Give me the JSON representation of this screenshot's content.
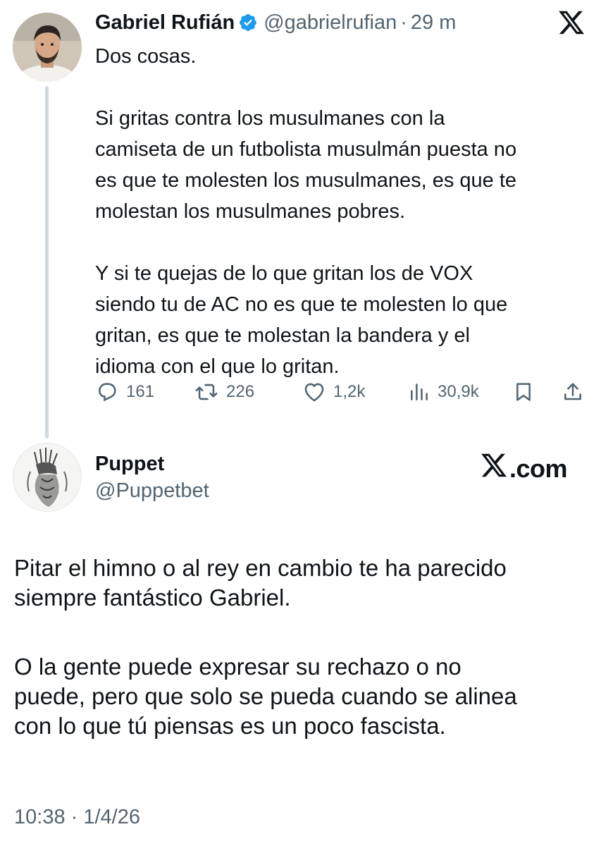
{
  "main_tweet": {
    "author_name": "Gabriel Rufián",
    "handle": "@gabrielrufian",
    "separator": "·",
    "time_ago": "29 m",
    "paragraphs": [
      "Dos cosas.",
      "Si gritas contra los musulmanes con la camiseta de un futbolista musulmán puesta no es que te molesten los musulmanes, es que te molestan los musulmanes pobres.",
      "Y si te quejas de lo que gritan los de VOX siendo tu de AC no es que te molesten lo que gritan, es que te molestan la bandera y el idioma con el que lo gritan."
    ],
    "lines": [
      "Si gritas contra los musulmanes con la",
      "camiseta de un futbolista musulmán puesta no",
      "es que te molesten los musulmanes, es que te",
      "molestan los musulmanes pobres.",
      "Y si te quejas de lo que gritan los de VOX",
      "siendo tu de AC no es que te molesten lo que",
      "gritan, es que te molestan la bandera y el",
      "idioma con el que lo gritan."
    ],
    "metrics": {
      "replies": "161",
      "reposts": "226",
      "likes": "1,2k",
      "views": "30,9k"
    }
  },
  "reply_tweet": {
    "author_name": "Puppet",
    "handle": "@Puppetbet",
    "brand": ".com",
    "lines": [
      "Pitar el himno o al rey en cambio te ha parecido",
      "siempre fantástico Gabriel.",
      "O la gente puede expresar su rechazo o no",
      "puede, pero que solo se pueda cuando se alinea",
      "con lo que tú piensas es un poco fascista."
    ],
    "timestamp": "10:38 · 1/4/26"
  },
  "icons": {
    "verified": "verified-badge-icon",
    "x_logo": "x-logo-icon",
    "reply": "reply-icon",
    "repost": "repost-icon",
    "like": "heart-icon",
    "views": "views-icon",
    "bookmark": "bookmark-icon",
    "share": "share-icon"
  },
  "colors": {
    "text": "#0f1419",
    "secondary": "#536471",
    "verified": "#1d9bf0",
    "thread_line": "#cfd9de"
  }
}
